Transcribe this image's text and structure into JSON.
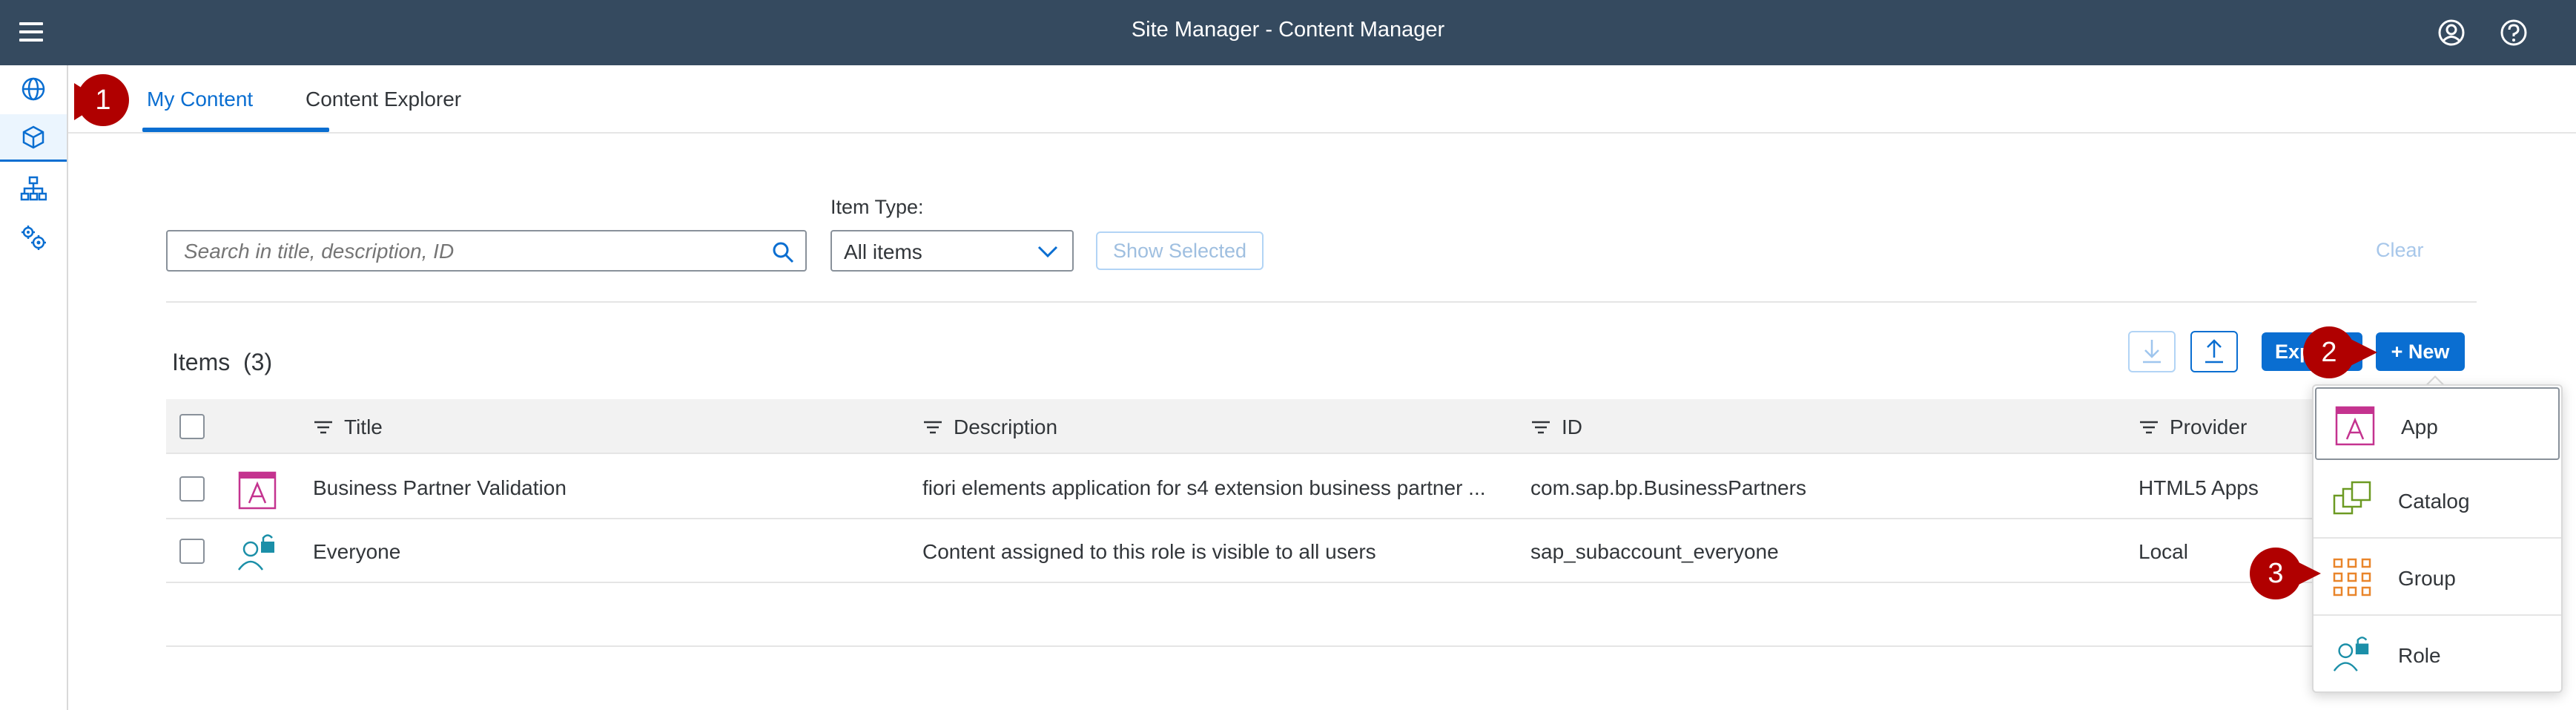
{
  "shell": {
    "title": "Site Manager - Content Manager",
    "menu_icon": "hamburger-menu-icon",
    "profile_icon": "user-profile-icon",
    "help_icon": "help-icon"
  },
  "sidenav": {
    "items": [
      {
        "icon": "globe-icon"
      },
      {
        "icon": "cube-icon",
        "active": true
      },
      {
        "icon": "hierarchy-icon"
      },
      {
        "icon": "settings-gears-icon"
      }
    ]
  },
  "tabs": [
    {
      "label": "My Content",
      "active": true
    },
    {
      "label": "Content Explorer",
      "active": false
    }
  ],
  "filters": {
    "search_placeholder": "Search in title, description, ID",
    "item_type_label": "Item Type:",
    "item_type_value": "All items",
    "show_selected_label": "Show Selected",
    "clear_label": "Clear"
  },
  "items": {
    "title": "Items",
    "count": "(3)",
    "export_label": "Export",
    "new_label": "+ New",
    "download_icon": "download-icon",
    "upload_icon": "upload-icon"
  },
  "table": {
    "columns": [
      "Title",
      "Description",
      "ID",
      "Provider"
    ],
    "rows": [
      {
        "icon": "app-icon",
        "title": "Business Partner Validation",
        "description": "fiori elements application for s4 extension business partner ...",
        "id": "com.sap.bp.BusinessPartners",
        "provider": "HTML5 Apps"
      },
      {
        "icon": "role-icon",
        "title": "Everyone",
        "description": "Content assigned to this role is visible to all users",
        "id": "sap_subaccount_everyone",
        "provider": "Local"
      }
    ]
  },
  "new_menu": {
    "items": [
      {
        "label": "App",
        "icon": "app-icon"
      },
      {
        "label": "Catalog",
        "icon": "catalog-icon"
      },
      {
        "label": "Group",
        "icon": "group-icon"
      },
      {
        "label": "Role",
        "icon": "role-icon"
      }
    ]
  },
  "callouts": [
    "1",
    "2",
    "3"
  ],
  "colors": {
    "shell": "#354a5f",
    "accent": "#0a6ed1",
    "callout": "#b00000",
    "app_icon": "#c4338f",
    "catalog_icon": "#6c9a23",
    "group_icon": "#e9852a",
    "role_icon": "#1b8fa8"
  }
}
